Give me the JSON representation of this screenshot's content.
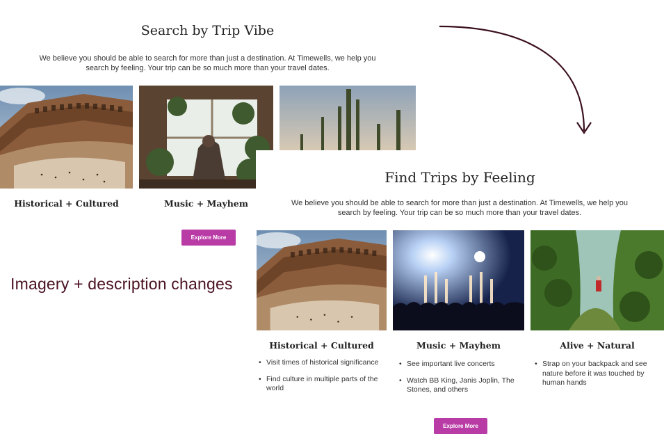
{
  "old": {
    "title": "Search by Trip Vibe",
    "description": "We believe you should be able to search for more than just a destination. At Timewells, we help you search by feeling. Your trip can be so much more than your travel dates.",
    "cards": [
      {
        "label": "Historical + Cultured",
        "image": "colosseum"
      },
      {
        "label": "Music + Mayhem",
        "image": "plant-room"
      },
      {
        "label": "",
        "image": "desert-cactus"
      }
    ],
    "button_label": "Explore More"
  },
  "annotation": "Imagery + description changes",
  "new": {
    "title": "Find Trips by Feeling",
    "description": "We believe you should be able to search for more than just a destination. At Timewells, we help you search by feeling. Your trip can be so much more than your travel dates.",
    "cards": [
      {
        "label": "Historical + Cultured",
        "image": "colosseum",
        "bullets": [
          "Visit times of historical significance",
          "Find culture in multiple parts of the world"
        ]
      },
      {
        "label": "Music + Mayhem",
        "image": "concert",
        "bullets": [
          "See important live concerts",
          "Watch BB King, Janis Joplin, The Stones, and others"
        ]
      },
      {
        "label": "Alive + Natural",
        "image": "forest-hiker",
        "bullets": [
          "Strap on your backpack and see nature before it was touched by human hands"
        ]
      }
    ],
    "button_label": "Explore More"
  },
  "colors": {
    "button": "#b93ca6",
    "annotation": "#4a1122",
    "arrow": "#3a0f1c"
  }
}
